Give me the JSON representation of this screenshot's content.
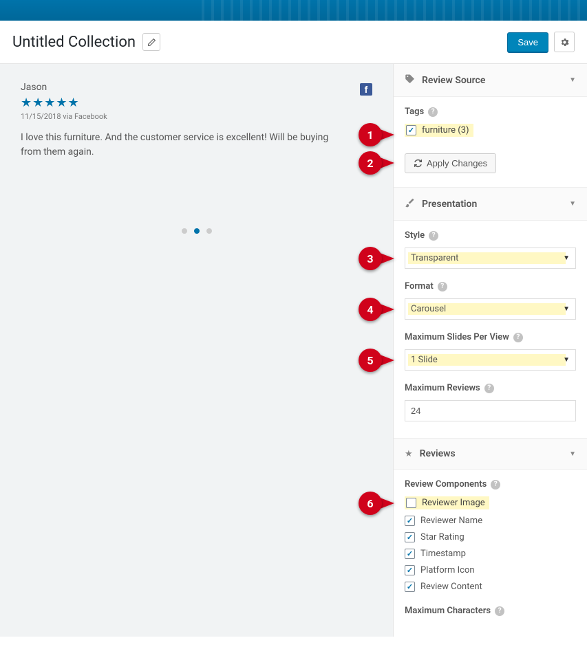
{
  "header": {
    "title": "Untitled Collection",
    "save_label": "Save"
  },
  "review": {
    "name": "Jason",
    "timestamp": "11/15/2018 via Facebook",
    "text": "I love this furniture. And the customer service is excellent! Will be buying from them again."
  },
  "panels": {
    "review_source": "Review Source",
    "presentation": "Presentation",
    "reviews": "Reviews"
  },
  "tags": {
    "label": "Tags",
    "item": "furniture (3)",
    "apply": "Apply Changes"
  },
  "presentation": {
    "style_label": "Style",
    "style_value": "Transparent",
    "format_label": "Format",
    "format_value": "Carousel",
    "slides_label": "Maximum Slides Per View",
    "slides_value": "1 Slide",
    "maxrev_label": "Maximum Reviews",
    "maxrev_value": "24"
  },
  "reviews_section": {
    "components_label": "Review Components",
    "items": {
      "reviewer_image": "Reviewer Image",
      "reviewer_name": "Reviewer Name",
      "star_rating": "Star Rating",
      "timestamp": "Timestamp",
      "platform_icon": "Platform Icon",
      "review_content": "Review Content"
    },
    "maxchars_label": "Maximum Characters"
  },
  "callouts": [
    "1",
    "2",
    "3",
    "4",
    "5",
    "6"
  ]
}
